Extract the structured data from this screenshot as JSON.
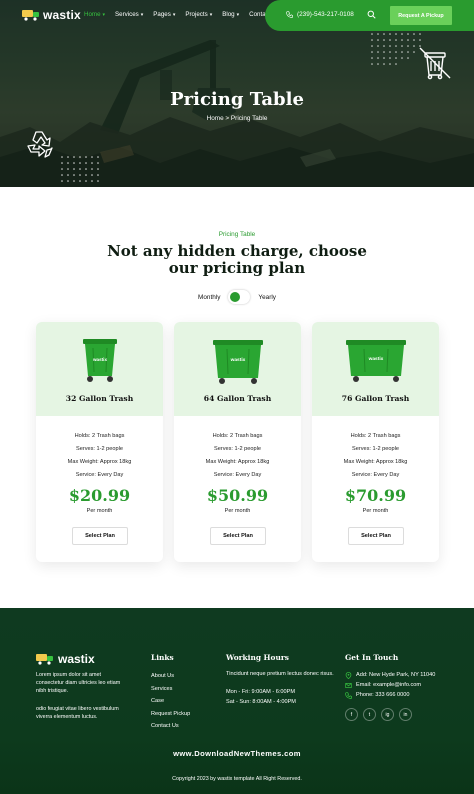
{
  "header": {
    "logo": "wastix",
    "nav": [
      {
        "label": "Home",
        "active": true,
        "dropdown": true
      },
      {
        "label": "Services",
        "active": false,
        "dropdown": true
      },
      {
        "label": "Pages",
        "active": false,
        "dropdown": true
      },
      {
        "label": "Projects",
        "active": false,
        "dropdown": true
      },
      {
        "label": "Blog",
        "active": false,
        "dropdown": true
      },
      {
        "label": "Contact",
        "active": false,
        "dropdown": false
      }
    ],
    "phone": "(239)-543-217-0108",
    "cta": "Request A Pickup"
  },
  "hero": {
    "title": "Pricing Table",
    "breadcrumb": "Home > Pricing Table"
  },
  "pricing": {
    "label": "Pricing Table",
    "title_line1": "Not any hidden charge, choose",
    "title_line2": "our pricing plan",
    "toggle": {
      "left": "Monthly",
      "right": "Yearly"
    },
    "bin_brand": "wastix",
    "plans": [
      {
        "name": "32 Gallon Trash",
        "features": [
          "Holds: 2 Trash bags",
          "Serves: 1-2 people",
          "Max Weight: Approx 18kg",
          "Service: Every Day"
        ],
        "price": "$20.99",
        "period": "Per month",
        "button": "Select Plan"
      },
      {
        "name": "64 Gallon Trash",
        "features": [
          "Holds: 2 Trash bags",
          "Serves: 1-2 people",
          "Max Weight: Approx 18kg",
          "Service: Every Day"
        ],
        "price": "$50.99",
        "period": "Per month",
        "button": "Select Plan"
      },
      {
        "name": "76 Gallon Trash",
        "features": [
          "Holds: 2 Trash bags",
          "Serves: 1-2 people",
          "Max Weight: Approx 18kg",
          "Service: Every Day"
        ],
        "price": "$70.99",
        "period": "Per month",
        "button": "Select Plan"
      }
    ]
  },
  "footer": {
    "logo": "wastix",
    "about_1": "Lorem ipsum dolor sit amet consectetur diam ultricies leo etiam nibh tristique.",
    "about_2": "odio feugiat vitae libero vestibulum viverra elementum luctus.",
    "links_heading": "Links",
    "links": [
      "About Us",
      "Services",
      "Case",
      "Request Pickup",
      "Contact Us"
    ],
    "hours_heading": "Working Hours",
    "hours_text": "Tincidunt neque pretium lectus donec risus.",
    "hours_1": "Mon - Fri: 9:00AM - 6:00PM",
    "hours_2": "Sat - Sun: 8:00AM - 4:00PM",
    "contact_heading": "Get In Touch",
    "address": "Add: New Hyde Park, NY 11040",
    "email": "Email: example@info.com",
    "phone": "Phone: 333 666 0000",
    "socials": [
      "f",
      "t",
      "ig",
      "in"
    ],
    "watermark": "www.DownloadNewThemes.com",
    "copyright": "Copyright 2023 by wastix template All Right Reserved."
  },
  "colors": {
    "brand_green": "#2a9b2f",
    "light_green": "#e5f5e3",
    "footer_green": "#0f3a20"
  }
}
